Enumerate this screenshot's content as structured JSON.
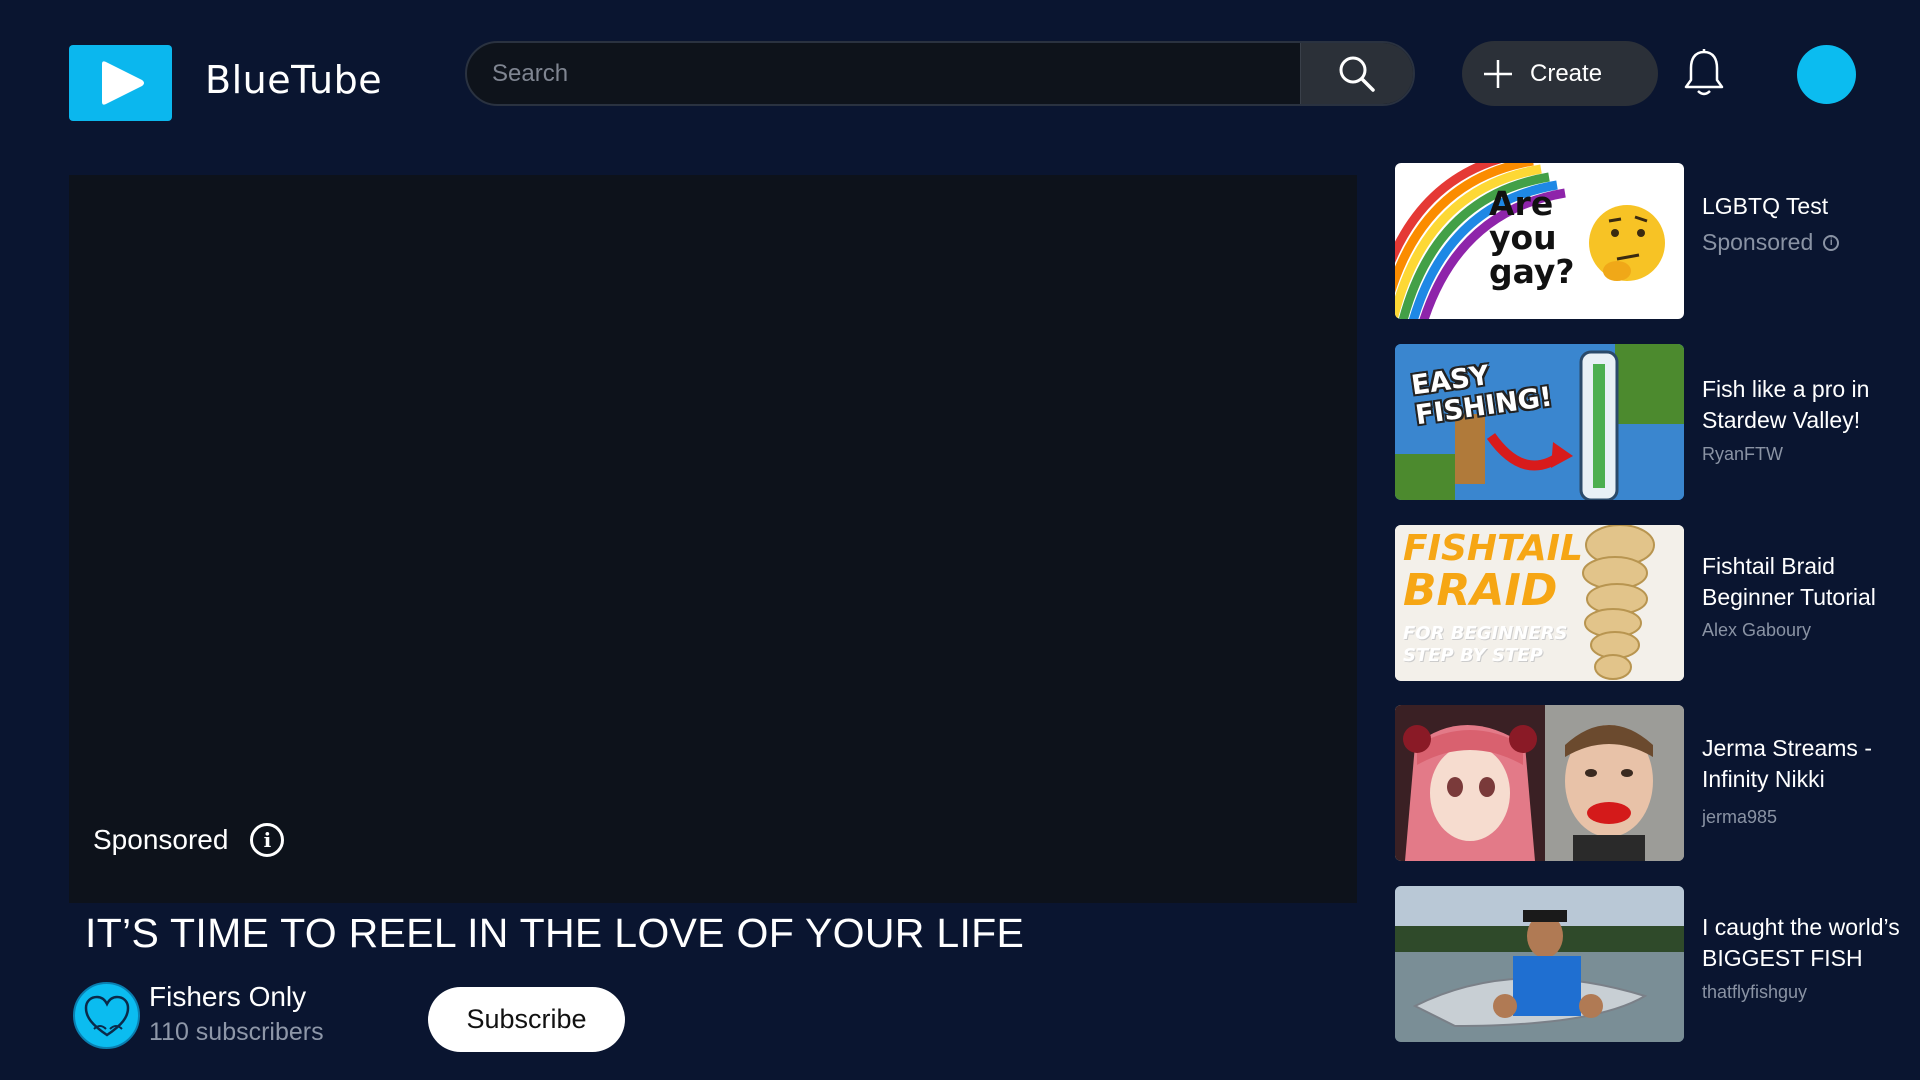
{
  "header": {
    "brand": "BlueTube",
    "search_placeholder": "Search",
    "create_label": "Create",
    "logo_icon": "play-logo-icon",
    "accent_color": "#0bb7ee"
  },
  "player": {
    "sponsored_label": "Sponsored",
    "title": "IT’S TIME TO REEL IN THE LOVE OF YOUR LIFE",
    "channel_name": "Fishers Only",
    "channel_subscribers": "110 subscribers",
    "subscribe_label": "Subscribe"
  },
  "sidebar": {
    "items": [
      {
        "title": "LGBTQ Test",
        "subtitle": "Sponsored",
        "thumb_text": [
          "Are",
          "you",
          "gay?"
        ]
      },
      {
        "title": "Fish like a pro in Stardew Valley!",
        "subtitle": "RyanFTW",
        "thumb_text": [
          "EASY",
          "FISHING!"
        ]
      },
      {
        "title": "Fishtail Braid Beginner Tutorial",
        "subtitle": "Alex Gaboury",
        "thumb_text": [
          "FISHTAIL",
          "BRAID",
          "FOR BEGINNERS",
          "STEP BY STEP"
        ]
      },
      {
        "title": "Jerma Streams - Infinity Nikki",
        "subtitle": "jerma985"
      },
      {
        "title": "I caught the world’s BIGGEST FISH",
        "subtitle": "thatflyfishguy"
      }
    ]
  }
}
